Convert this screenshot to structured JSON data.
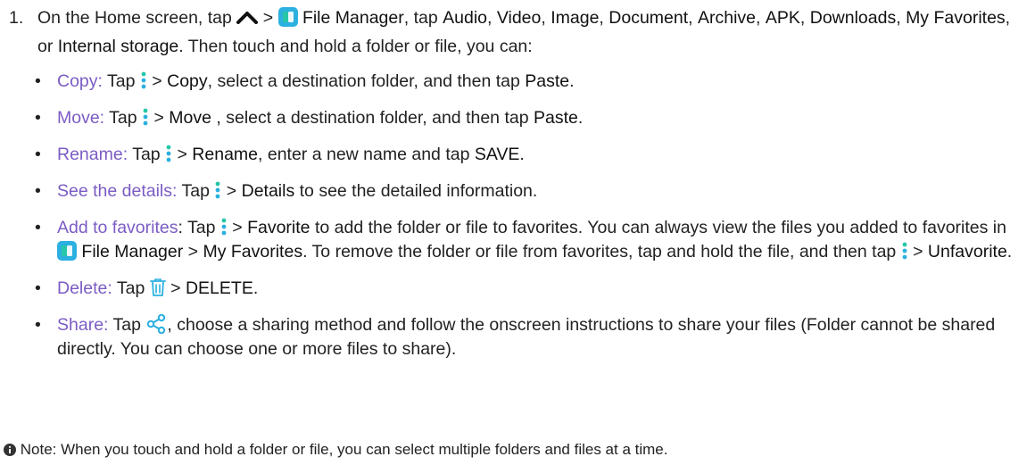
{
  "step1": {
    "number": "1.",
    "p1": "On the Home screen, tap ",
    "p2": " > ",
    "file_manager": "File Manager",
    "p3": ", tap ",
    "audio": "Audio",
    "sep": ", ",
    "video": "Video",
    "image": "Image",
    "document": "Document",
    "archive": "Archive",
    "apk": "APK",
    "downloads": "Downloads",
    "favorites": "My Favorites",
    "or": ", or ",
    "internal": "Internal storage",
    "p4": ". Then touch and hold a folder or file, you can:"
  },
  "options": {
    "copy": {
      "label": "Copy:",
      "t1": " Tap ",
      "t2": " > ",
      "action": "Copy",
      "t3": ", select a destination folder, and then tap ",
      "paste": "Paste",
      "t4": "."
    },
    "move": {
      "label": "Move:",
      "t1": " Tap ",
      "t2": " > ",
      "action": "Move",
      "t3": " , select a destination folder, and then tap ",
      "paste": "Paste",
      "t4": "."
    },
    "rename": {
      "label": "Rename:",
      "t1": " Tap ",
      "t2": " > ",
      "action": "Rename",
      "t3": ", enter a new name and tap ",
      "save": "SAVE",
      "t4": "."
    },
    "details": {
      "label": "See the details:",
      "t1": " Tap ",
      "t2": " > ",
      "action": "Details",
      "t3": " to see the detailed information."
    },
    "favorite": {
      "label": "Add to favorites",
      "t1": ": Tap ",
      "t2": " > ",
      "action": "Favorite",
      "t3": " to add the folder or file to favorites. You can always view the files you added to favorites in ",
      "file_manager": "File Manager",
      "t4": " > ",
      "my_favorites": "My Favorites",
      "t5": ". To remove the folder or file from favorites, tap and hold the file, and then tap ",
      "t6": " > ",
      "unfavorite": "Unfavorite",
      "t7": "."
    },
    "delete": {
      "label": "Delete:",
      "t1": " Tap ",
      "t2": " > ",
      "action": "DELETE",
      "t3": "."
    },
    "share": {
      "label": "Share:",
      "t1": " Tap ",
      "t2": ", choose a sharing method and follow the onscreen instructions to share your files (Folder cannot be shared directly. You can choose one or more files to share)."
    }
  },
  "bullet": "•",
  "note": {
    "text": "Note: When you touch and hold a folder or file, you can select multiple folders and files at a time."
  },
  "icons": {
    "chevron": "chevron-up-icon",
    "app": "file-manager-app-icon",
    "menu": "more-vertical-icon",
    "trash": "trash-icon",
    "share": "share-icon",
    "info": "info-icon"
  },
  "colors": {
    "accent": "#7b5cc4",
    "icon_blue": "#2bb0e0",
    "icon_teal": "#26c6a8"
  }
}
